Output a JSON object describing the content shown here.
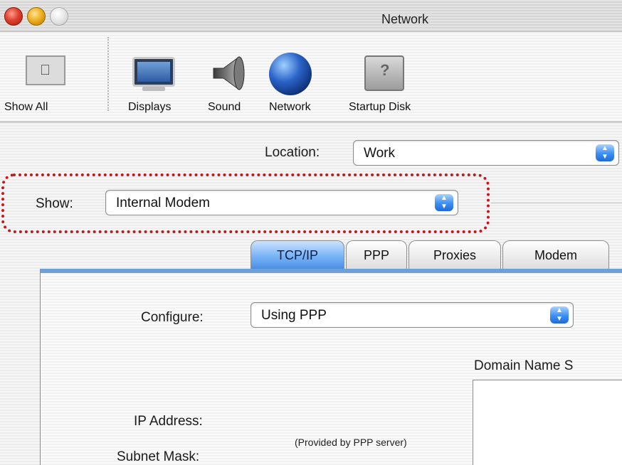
{
  "window": {
    "title": "Network"
  },
  "toolbar": {
    "items": [
      {
        "label": "Show All",
        "icon": "show-all-icon"
      },
      {
        "label": "Displays",
        "icon": "displays-icon"
      },
      {
        "label": "Sound",
        "icon": "speaker-icon"
      },
      {
        "label": "Network",
        "icon": "globe-icon"
      },
      {
        "label": "Startup Disk",
        "icon": "hard-disk-icon"
      }
    ]
  },
  "location": {
    "label": "Location:",
    "value": "Work"
  },
  "show": {
    "label": "Show:",
    "value": "Internal Modem"
  },
  "tabs": [
    {
      "label": "TCP/IP",
      "active": true
    },
    {
      "label": "PPP",
      "active": false
    },
    {
      "label": "Proxies",
      "active": false
    },
    {
      "label": "Modem",
      "active": false
    }
  ],
  "tcpip": {
    "configure_label": "Configure:",
    "configure_value": "Using PPP",
    "dns_label": "Domain Name S",
    "ip_label": "IP Address:",
    "ip_note": "(Provided by PPP server)",
    "subnet_label": "Subnet Mask:"
  },
  "colors": {
    "highlight": "#c4161c",
    "accent": "#4a90e6"
  }
}
